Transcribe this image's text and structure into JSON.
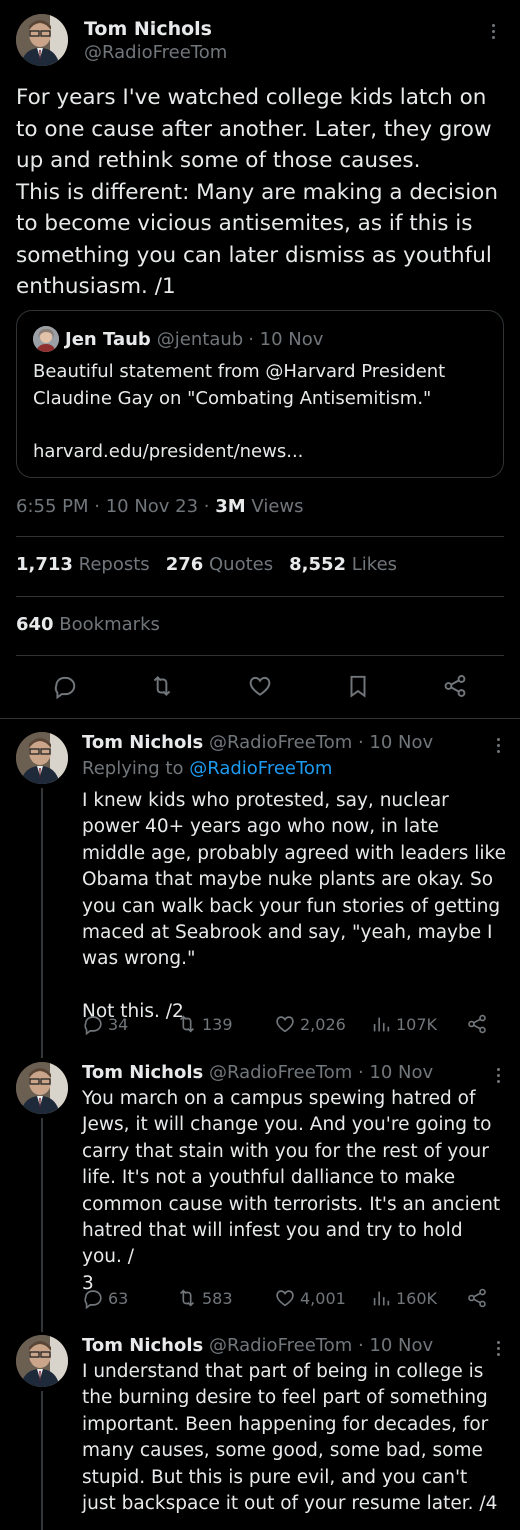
{
  "main_tweet": {
    "author_name": "Tom Nichols",
    "author_handle": "@RadioFreeTom",
    "text": "For years I've watched college kids latch on to one cause after another. Later, they grow up and rethink some of those causes.\nThis is different: Many are making a decision to become vicious antisemites, as if this is something you can later dismiss as youthful enthusiasm. /1",
    "quote": {
      "author_name": "Jen Taub",
      "author_handle": "@jentaub",
      "date": "· 10 Nov",
      "text": "Beautiful statement from @Harvard President Claudine Gay on \"Combating Antisemitism.\"\n\nharvard.edu/president/news..."
    },
    "time": "6:55 PM · 10 Nov 23 · ",
    "views_count": "3M",
    "views_label": " Views",
    "reposts_count": "1,713",
    "reposts_label": " Reposts",
    "quotes_count": "276",
    "quotes_label": " Quotes",
    "likes_count": "8,552",
    "likes_label": " Likes",
    "bookmarks_count": "640",
    "bookmarks_label": " Bookmarks"
  },
  "replies": [
    {
      "author_name": "Tom Nichols",
      "author_handle": "@RadioFreeTom",
      "date": "· 10 Nov",
      "replying_prefix": "Replying to ",
      "replying_handle": "@RadioFreeTom",
      "text": "I knew kids who protested, say, nuclear power 40+ years ago who now, in late middle age, probably agreed with leaders like Obama that maybe nuke plants are okay. So you can walk back your fun stories of getting maced at Seabrook and say, \"yeah, maybe I was wrong.\"\n\nNot this. /2",
      "replies": "34",
      "reposts": "139",
      "likes": "2,026",
      "views": "107K"
    },
    {
      "author_name": "Tom Nichols",
      "author_handle": "@RadioFreeTom",
      "date": "· 10 Nov",
      "text": "You march on a campus spewing hatred of Jews, it will change you. And you're going to carry that stain with you for the rest of your life. It's not a youthful dalliance to make common cause with terrorists. It's an ancient hatred that will infest you and try to hold you. /\n3",
      "replies": "63",
      "reposts": "583",
      "likes": "4,001",
      "views": "160K"
    },
    {
      "author_name": "Tom Nichols",
      "author_handle": "@RadioFreeTom",
      "date": "· 10 Nov",
      "text": "I understand that part of being in college is the burning desire to feel part of something important. Been happening for decades, for many causes, some good, some bad, some stupid. But this is pure evil, and you can't just backspace it out of your resume later. /4"
    }
  ],
  "colors": {
    "background": "#000000",
    "text": "#e7e9ea",
    "muted": "#71767b",
    "link": "#1d9bf0",
    "border": "#2f3336"
  }
}
